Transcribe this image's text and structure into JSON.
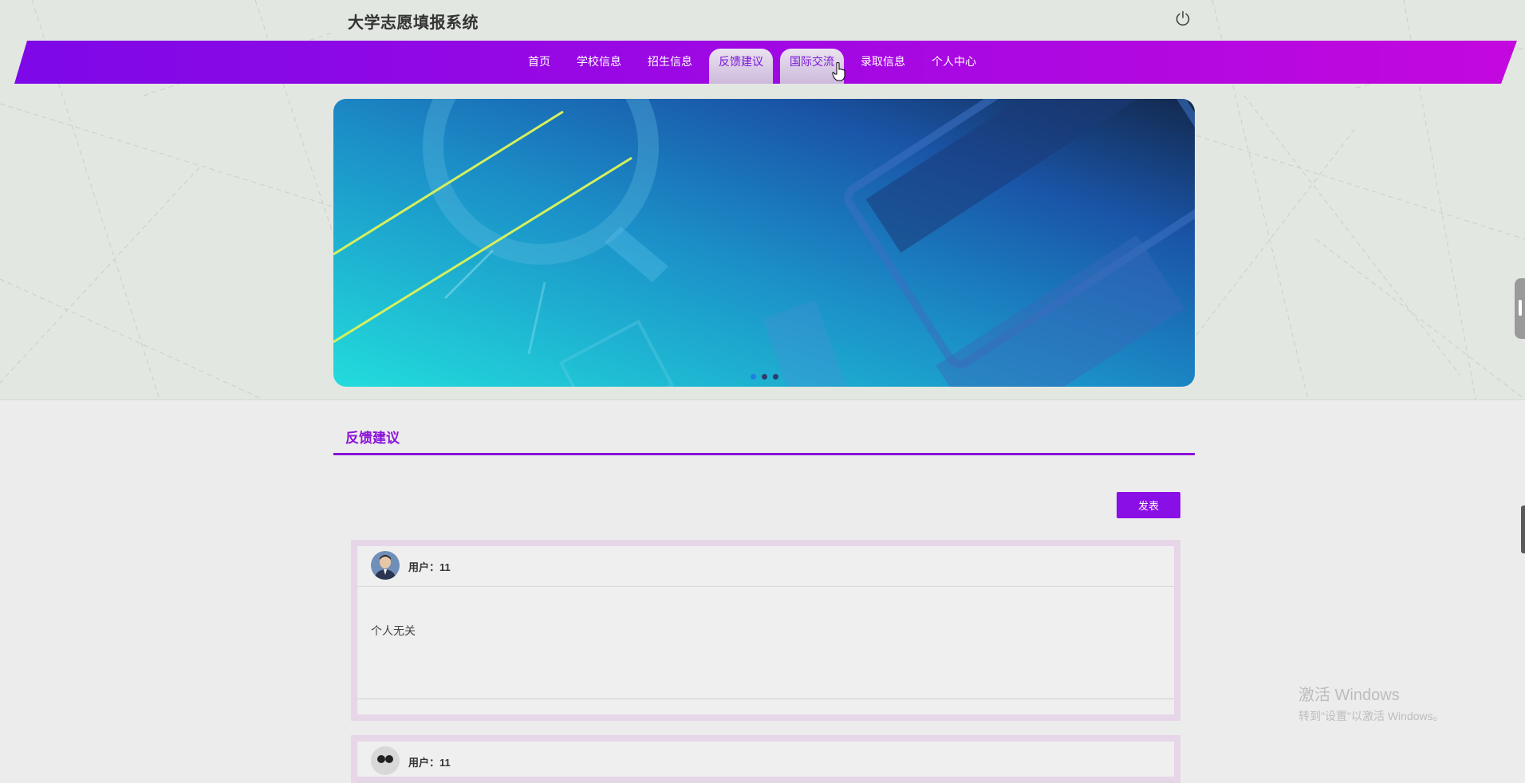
{
  "header": {
    "site_title": "大学志愿填报系统",
    "logout_icon": "power-icon"
  },
  "nav": {
    "items": [
      {
        "label": "首页"
      },
      {
        "label": "学校信息"
      },
      {
        "label": "招生信息"
      },
      {
        "label": "反馈建议",
        "active": true
      },
      {
        "label": "国际交流",
        "hover": true
      },
      {
        "label": "录取信息"
      },
      {
        "label": "个人中心"
      }
    ],
    "gradient_start": "#7d08e8",
    "gradient_end": "#c308de"
  },
  "banner": {
    "slide_count": 3,
    "active_slide": 1
  },
  "section": {
    "title": "反馈建议",
    "publish_label": "发表"
  },
  "posts": [
    {
      "user_label": "用户：",
      "user_name": "11",
      "content": "个人无关"
    },
    {
      "user_label": "用户：",
      "user_name": "11",
      "content": ""
    }
  ],
  "watermark": {
    "line1": "激活 Windows",
    "line2": "转到\"设置\"以激活 Windows。"
  },
  "colors": {
    "accent": "#8a12d8",
    "button": "#8a0ee6",
    "card_border": "#e6d6e8"
  }
}
